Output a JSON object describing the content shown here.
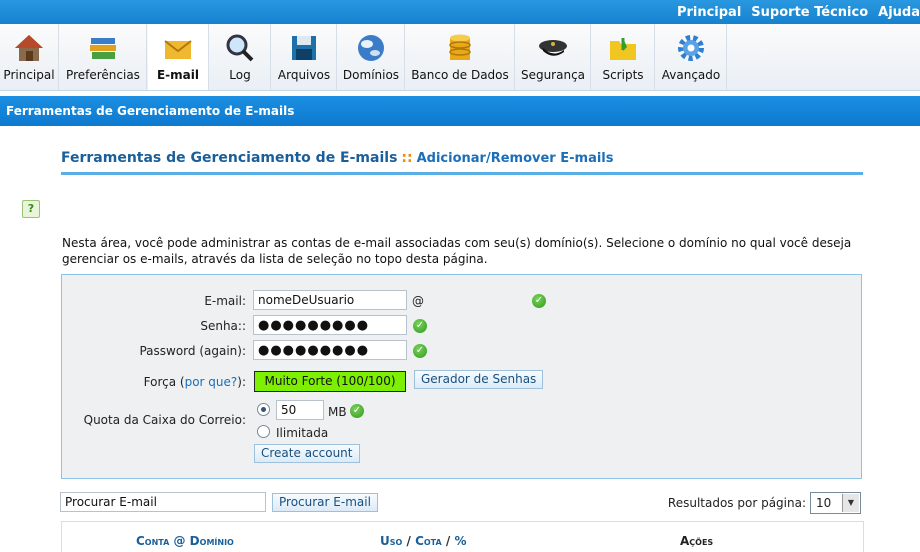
{
  "top_links": [
    "Principal",
    "Suporte Técnico",
    "Ajuda"
  ],
  "toolbar": [
    {
      "label": "Principal",
      "icon": "house-icon"
    },
    {
      "label": "Preferências",
      "icon": "books-icon"
    },
    {
      "label": "E-mail",
      "icon": "envelope-icon",
      "active": true
    },
    {
      "label": "Log",
      "icon": "magnifier-icon"
    },
    {
      "label": "Arquivos",
      "icon": "floppy-icon"
    },
    {
      "label": "Domínios",
      "icon": "globe-icon"
    },
    {
      "label": "Banco de Dados",
      "icon": "database-icon"
    },
    {
      "label": "Segurança",
      "icon": "police-cap-icon"
    },
    {
      "label": "Scripts",
      "icon": "folder-icon"
    },
    {
      "label": "Avançado",
      "icon": "gear-icon"
    }
  ],
  "subbar_title": "Ferramentas de Gerenciamento de E-mails",
  "heading": {
    "title": "Ferramentas de Gerenciamento de E-mails",
    "separator": "::",
    "subtitle": "Adicionar/Remover E-mails"
  },
  "help_icon": "?",
  "description": "Nesta área, você pode administrar as contas de e-mail associadas com seu(s) domínio(s). Selecione o domínio no qual você deseja gerenciar os e-mails, através da lista de seleção no topo desta página.",
  "form": {
    "email_label": "E-mail:",
    "email_value": "nomeDeUsuario",
    "at_sign": "@",
    "senha_label": "Senha::",
    "senha_value": "●●●●●●●●●",
    "password_again_label": "Password (again):",
    "password_again_value": "●●●●●●●●●",
    "forca_label": "Força",
    "forca_open": "(",
    "forca_link": "por que?",
    "forca_close": "):",
    "strength_value": "Muito Forte (100/100)",
    "generator_button": "Gerador de Senhas",
    "quota_label": "Quota da Caixa do Correio:",
    "quota_value": "50",
    "quota_unit": "MB",
    "unlimited_label": "Ilimitada",
    "create_button": "Create account",
    "colors": {
      "strength_bg": "#7cf000",
      "check": "#2f9a1c"
    }
  },
  "search": {
    "input_value": "Procurar E-mail",
    "button_label": "Procurar E-mail",
    "results_label": "Resultados por página:",
    "results_value": "10"
  },
  "table_headers": {
    "conta": "Conta @ Domínio",
    "uso": "Uso",
    "cota": "Cota",
    "pct": "%",
    "slash": "/",
    "acoes": "Ações"
  },
  "colors": {
    "top_bar": "#1a8ad6",
    "subbar": "#1187dc",
    "heading": "#1a5f99"
  }
}
